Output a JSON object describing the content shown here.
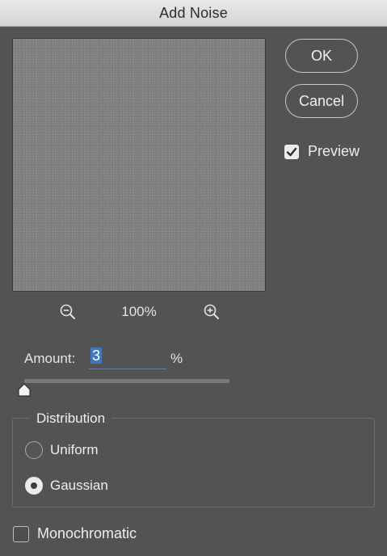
{
  "window": {
    "title": "Add Noise"
  },
  "buttons": {
    "ok_label": "OK",
    "cancel_label": "Cancel"
  },
  "preview": {
    "label": "Preview",
    "checked": true
  },
  "zoom": {
    "level": "100%",
    "zoom_out_icon": "zoom-out-magnifier",
    "zoom_in_icon": "zoom-in-magnifier"
  },
  "amount": {
    "label": "Amount:",
    "value": "3",
    "unit": "%",
    "slider_fraction": 0.0
  },
  "distribution": {
    "title": "Distribution",
    "options": [
      {
        "label": "Uniform",
        "selected": false
      },
      {
        "label": "Gaussian",
        "selected": true
      }
    ]
  },
  "monochromatic": {
    "label": "Monochromatic",
    "checked": false
  },
  "colors": {
    "panel": "#535353",
    "titlebar": "#dcdcdc",
    "focus_accent": "#3b78c8"
  }
}
